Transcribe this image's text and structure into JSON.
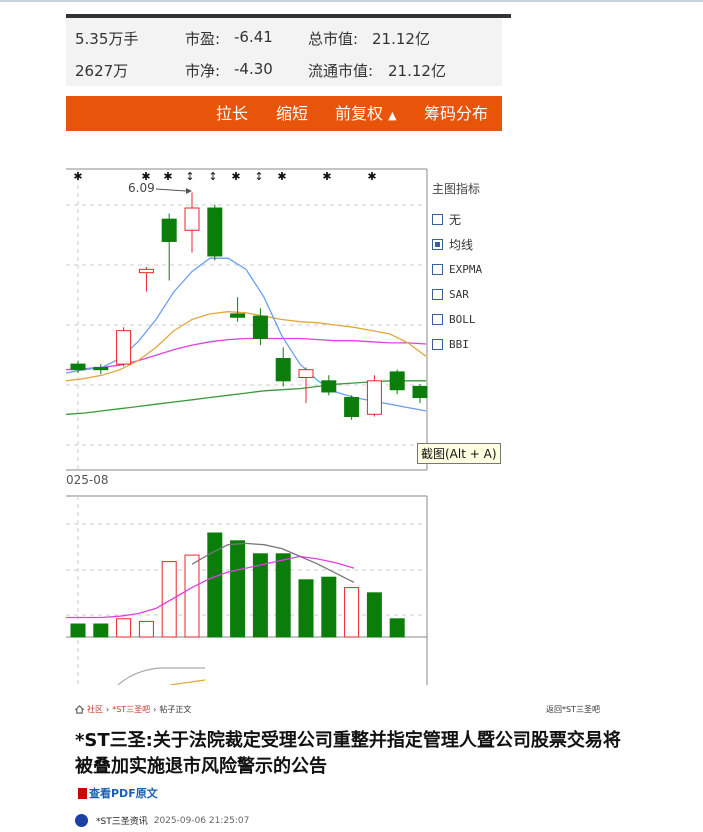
{
  "stats": {
    "row1": [
      {
        "value": "5.35万手"
      },
      {
        "label": "市盈:",
        "value": "-6.41"
      },
      {
        "label": "总市值:",
        "value": "21.12亿"
      }
    ],
    "row2": [
      {
        "value": "2627万"
      },
      {
        "label": "市净:",
        "value": "-4.30"
      },
      {
        "label": "流通市值:",
        "value": "21.12亿"
      }
    ]
  },
  "toolbar": {
    "stretch": "拉长",
    "shrink": "缩短",
    "fq": "前复权",
    "fq_arrow": "▲",
    "chips": "筹码分布"
  },
  "chart": {
    "high_label": "6.09",
    "date_label": "025-08",
    "tooltip": "截图(Alt + A)"
  },
  "chart_data": [
    {
      "type": "candlestick",
      "candles": [
        {
          "o": 4.55,
          "c": 4.5,
          "h": 4.58,
          "l": 4.47
        },
        {
          "o": 4.52,
          "c": 4.5,
          "h": 4.55,
          "l": 4.46
        },
        {
          "o": 4.55,
          "c": 4.85,
          "h": 4.88,
          "l": 4.53
        },
        {
          "o": 5.37,
          "c": 5.4,
          "h": 5.42,
          "l": 5.2
        },
        {
          "o": 5.85,
          "c": 5.65,
          "h": 5.9,
          "l": 5.3
        },
        {
          "o": 5.75,
          "c": 5.95,
          "h": 6.09,
          "l": 5.55
        },
        {
          "o": 5.95,
          "c": 5.52,
          "h": 5.98,
          "l": 5.48
        },
        {
          "o": 5.0,
          "c": 4.97,
          "h": 5.15,
          "l": 4.93
        },
        {
          "o": 4.98,
          "c": 4.78,
          "h": 5.05,
          "l": 4.72
        },
        {
          "o": 4.6,
          "c": 4.4,
          "h": 4.7,
          "l": 4.35
        },
        {
          "o": 4.43,
          "c": 4.5,
          "h": 4.52,
          "l": 4.2
        },
        {
          "o": 4.4,
          "c": 4.3,
          "h": 4.45,
          "l": 4.27
        },
        {
          "o": 4.25,
          "c": 4.08,
          "h": 4.27,
          "l": 4.05
        },
        {
          "o": 4.1,
          "c": 4.4,
          "h": 4.45,
          "l": 4.08
        },
        {
          "o": 4.48,
          "c": 4.32,
          "h": 4.5,
          "l": 4.28
        },
        {
          "o": 4.35,
          "c": 4.25,
          "h": 4.37,
          "l": 4.2
        }
      ],
      "ma5": [
        4.47,
        4.5,
        4.52,
        4.6,
        4.75,
        4.95,
        5.2,
        5.38,
        5.5,
        5.5,
        5.4,
        5.15,
        4.8,
        4.55,
        4.4,
        4.3,
        4.25,
        4.22,
        4.19,
        4.16,
        4.13
      ],
      "ma10": [
        4.4,
        4.42,
        4.45,
        4.5,
        4.58,
        4.7,
        4.85,
        4.95,
        5.0,
        5.02,
        5.01,
        4.98,
        4.95,
        4.93,
        4.92,
        4.9,
        4.88,
        4.85,
        4.82,
        4.74,
        4.62
      ],
      "ma20": [
        4.5,
        4.51,
        4.52,
        4.54,
        4.58,
        4.63,
        4.68,
        4.72,
        4.75,
        4.77,
        4.78,
        4.78,
        4.78,
        4.78,
        4.77,
        4.76,
        4.76,
        4.75,
        4.74,
        4.74,
        4.73
      ],
      "ma60": [
        4.1,
        4.11,
        4.13,
        4.15,
        4.17,
        4.19,
        4.21,
        4.23,
        4.25,
        4.27,
        4.29,
        4.31,
        4.32,
        4.33,
        4.35,
        4.37,
        4.38,
        4.39,
        4.4,
        4.4,
        4.4
      ]
    },
    {
      "type": "bar",
      "volumes": [
        {
          "v": 1.0,
          "up": false
        },
        {
          "v": 1.0,
          "up": false
        },
        {
          "v": 1.4,
          "up": true
        },
        {
          "v": 1.2,
          "up": true
        },
        {
          "v": 5.8,
          "up": true
        },
        {
          "v": 6.3,
          "up": true
        },
        {
          "v": 8.0,
          "up": false
        },
        {
          "v": 7.4,
          "up": false
        },
        {
          "v": 6.4,
          "up": false
        },
        {
          "v": 6.4,
          "up": false
        },
        {
          "v": 4.4,
          "up": false
        },
        {
          "v": 4.6,
          "up": false
        },
        {
          "v": 3.8,
          "up": true
        },
        {
          "v": 3.4,
          "up": false
        },
        {
          "v": 1.4,
          "up": false
        }
      ],
      "vma5": [
        1.5,
        1.5,
        1.5,
        1.6,
        1.8,
        2.2,
        3.0,
        3.8,
        4.5,
        5.0,
        5.3,
        5.6,
        5.9,
        6.2,
        6.0,
        5.7,
        5.3
      ],
      "vma10": [
        null,
        null,
        null,
        null,
        null,
        null,
        null,
        5.6,
        6.4,
        7.1,
        7.2,
        7.1,
        6.8,
        6.2,
        5.6,
        4.9,
        4.2
      ]
    }
  ],
  "indicators": {
    "title": "主图指标",
    "items": [
      {
        "label": "无",
        "checked": false,
        "mono": false
      },
      {
        "label": "均线",
        "checked": true,
        "mono": false
      },
      {
        "label": "EXPMA",
        "checked": false,
        "mono": true
      },
      {
        "label": "SAR",
        "checked": false,
        "mono": true
      },
      {
        "label": "BOLL",
        "checked": false,
        "mono": true
      },
      {
        "label": "BBI",
        "checked": false,
        "mono": true
      }
    ]
  },
  "post": {
    "crumbs": [
      "社区",
      "*ST三圣吧",
      "帖子正文"
    ],
    "back": "返回*ST三圣吧",
    "title": "*ST三圣:关于法院裁定受理公司重整并指定管理人暨公司股票交易将被叠加实施退市风险警示的公告",
    "pdf": "查看PDF原文",
    "author": "*ST三圣资讯",
    "time": "2025-09-06 21:25:07"
  },
  "colors": {
    "up": "#e8242a",
    "down": "#0b7d0b",
    "accent": "#e8540a"
  }
}
